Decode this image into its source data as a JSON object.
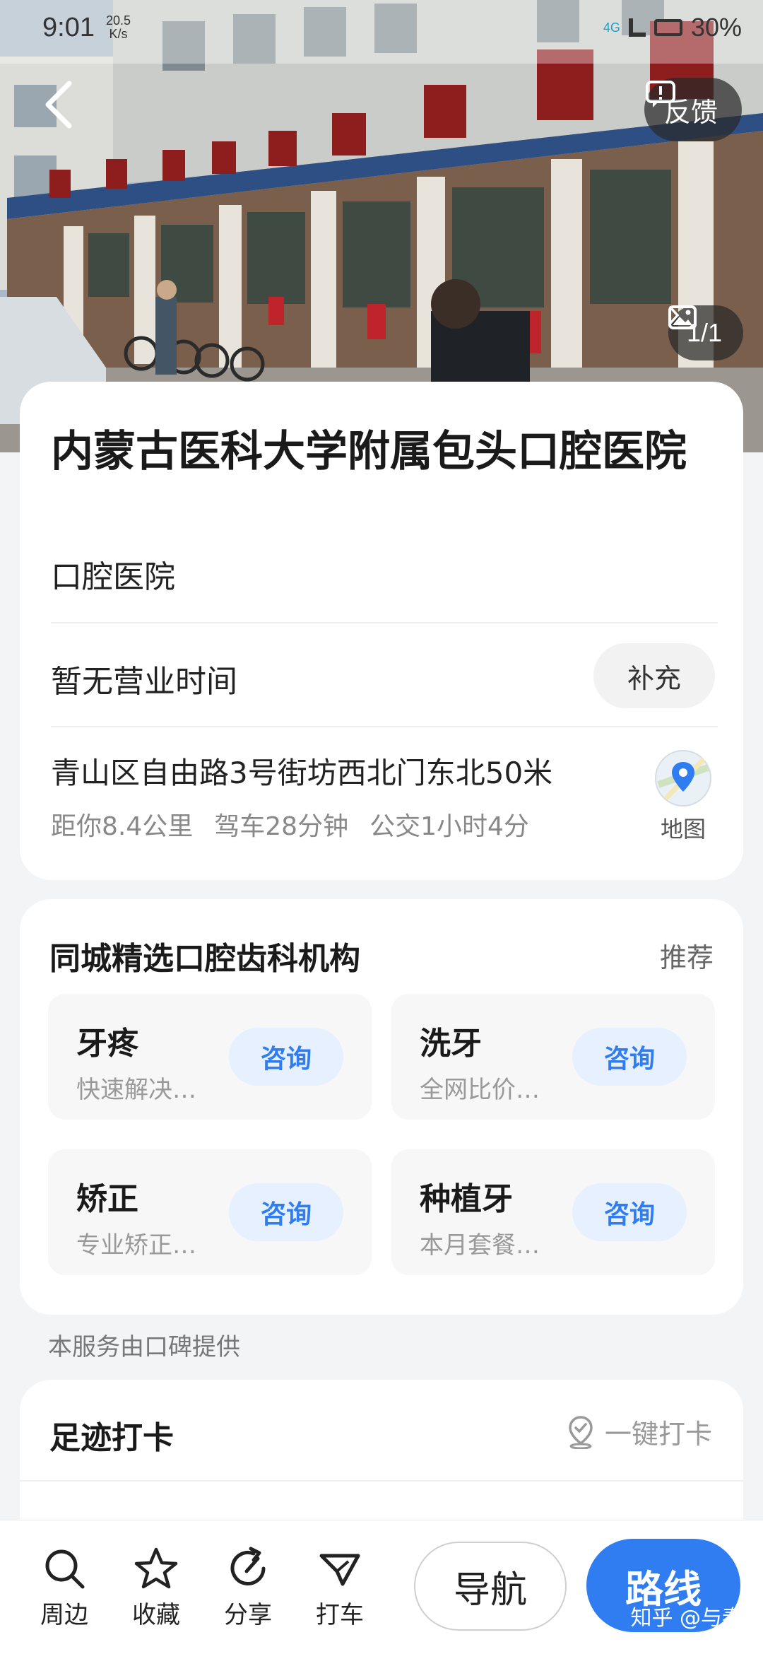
{
  "status_bar": {
    "time": "9:01",
    "speed_value": "20.5",
    "speed_unit": "K/s",
    "network": "4G",
    "battery": "30%"
  },
  "header": {
    "feedback_label": "反馈",
    "photo_counter": "1/1"
  },
  "poi": {
    "name": "内蒙古医科大学附属包头口腔医院",
    "category": "口腔医院",
    "hours": "暂无营业时间",
    "supplement_label": "补充",
    "address": "青山区自由路3号街坊西北门东北50米",
    "distance": "距你8.4公里",
    "drive_time": "驾车28分钟",
    "bus_time": "公交1小时4分",
    "map_label": "地图"
  },
  "recommendations": {
    "title": "同城精选口腔齿科机构",
    "tag": "推荐",
    "items": [
      {
        "title": "牙疼",
        "subtitle": "快速解决…",
        "button": "咨询"
      },
      {
        "title": "洗牙",
        "subtitle": "全网比价…",
        "button": "咨询"
      },
      {
        "title": "矫正",
        "subtitle": "专业矫正…",
        "button": "咨询"
      },
      {
        "title": "种植牙",
        "subtitle": "本月套餐…",
        "button": "咨询"
      }
    ],
    "provider_note": "本服务由口碑提供"
  },
  "checkin": {
    "title": "足迹打卡",
    "action_label": "一键打卡"
  },
  "bottom_bar": {
    "nearby": "周边",
    "favorite": "收藏",
    "share": "分享",
    "taxi": "打车",
    "navigate": "导航",
    "route": "路线"
  },
  "watermark": "知乎 @与秦",
  "colors": {
    "accent": "#2f7df0",
    "consult_bg": "#e6f0ff",
    "page_bg": "#f3f4f6"
  }
}
